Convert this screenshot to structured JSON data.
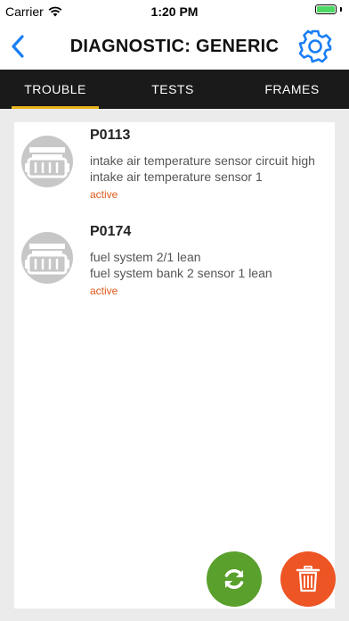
{
  "status_bar": {
    "carrier": "Carrier",
    "time": "1:20 PM"
  },
  "nav": {
    "title": "DIAGNOSTIC: GENERIC"
  },
  "tabs": [
    {
      "label": "TROUBLE",
      "active": true
    },
    {
      "label": "TESTS",
      "active": false
    },
    {
      "label": "FRAMES",
      "active": false
    }
  ],
  "items": [
    {
      "code": "P0113",
      "line1": "intake air temperature sensor circuit high",
      "line2": "intake air temperature sensor 1",
      "status": "active"
    },
    {
      "code": "P0174",
      "line1": "fuel system 2/1 lean",
      "line2": "fuel system bank 2 sensor 1 lean",
      "status": "active"
    }
  ],
  "colors": {
    "accent_blue": "#1a7ef5",
    "tab_underline": "#e8b21a",
    "status_orange": "#e05a1c",
    "refresh_green": "#5aa02c",
    "delete_orange": "#ee5524"
  }
}
